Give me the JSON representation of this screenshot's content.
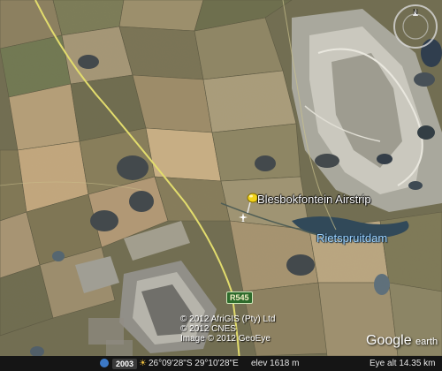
{
  "map": {
    "place_label": "Blesbokfontein Airstrip",
    "water_label": "Rietspruitdam",
    "road_shield": "R545",
    "compass_north": "N"
  },
  "copyright": {
    "line1": "© 2012 AfriGIS (Pty) Ltd",
    "line2": "© 2012 CNES",
    "line3": "Image © 2012 GeoEye"
  },
  "branding": {
    "google": "Google",
    "earth": "earth"
  },
  "status_bar": {
    "year": "2003",
    "coordinates": "26°09'28\"S  29°10'28\"E",
    "elevation": "elev 1618 m",
    "eye_alt": "Eye alt  14.35 km"
  },
  "colors": {
    "road": "#e2dc6a",
    "placemark_pin": "#f2d31b",
    "water_label": "#9ed3ff",
    "route_shield": "#2e6b2c"
  },
  "icons": [
    "pushpin-icon",
    "airport-icon",
    "compass-icon",
    "street-view-icon",
    "sun-icon"
  ]
}
